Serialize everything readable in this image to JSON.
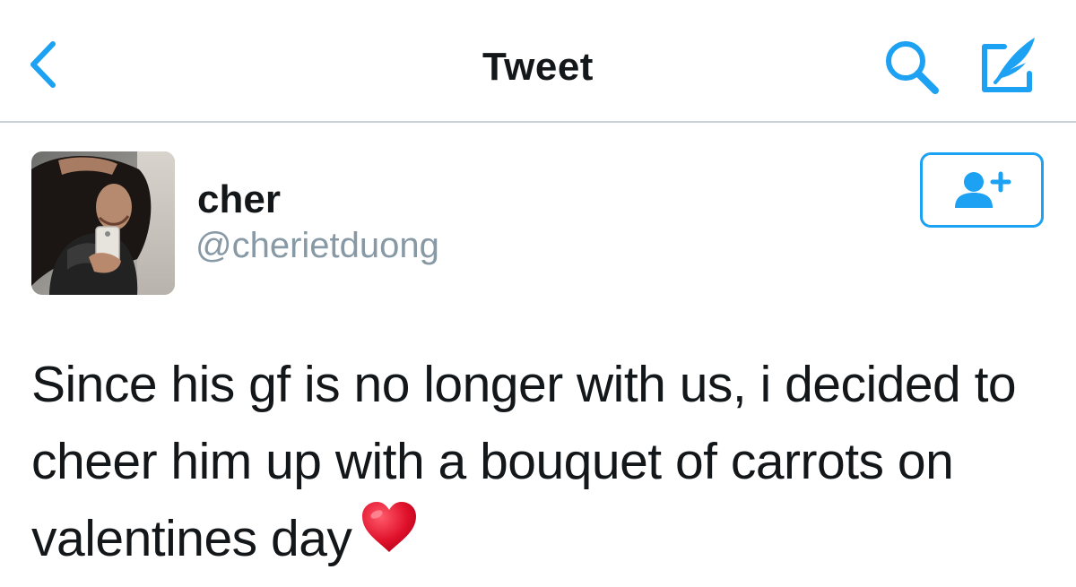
{
  "navbar": {
    "title": "Tweet",
    "back_icon": "chevron-left-icon",
    "search_icon": "search-icon",
    "compose_icon": "compose-tweet-icon"
  },
  "tweet": {
    "author": {
      "display_name": "cher",
      "handle": "@cherietduong",
      "avatar": "profile-photo"
    },
    "follow_icon": "add-user-icon",
    "text": "Since his gf is no longer with us, i decided to cheer him up with a bouquet of carrots on valentines day",
    "emoji": "red-heart-emoji"
  },
  "colors": {
    "accent": "#1da1f2",
    "text": "#14171a",
    "muted": "#8899a6",
    "divider": "#c9d3dc",
    "heart": "#e0112b"
  }
}
